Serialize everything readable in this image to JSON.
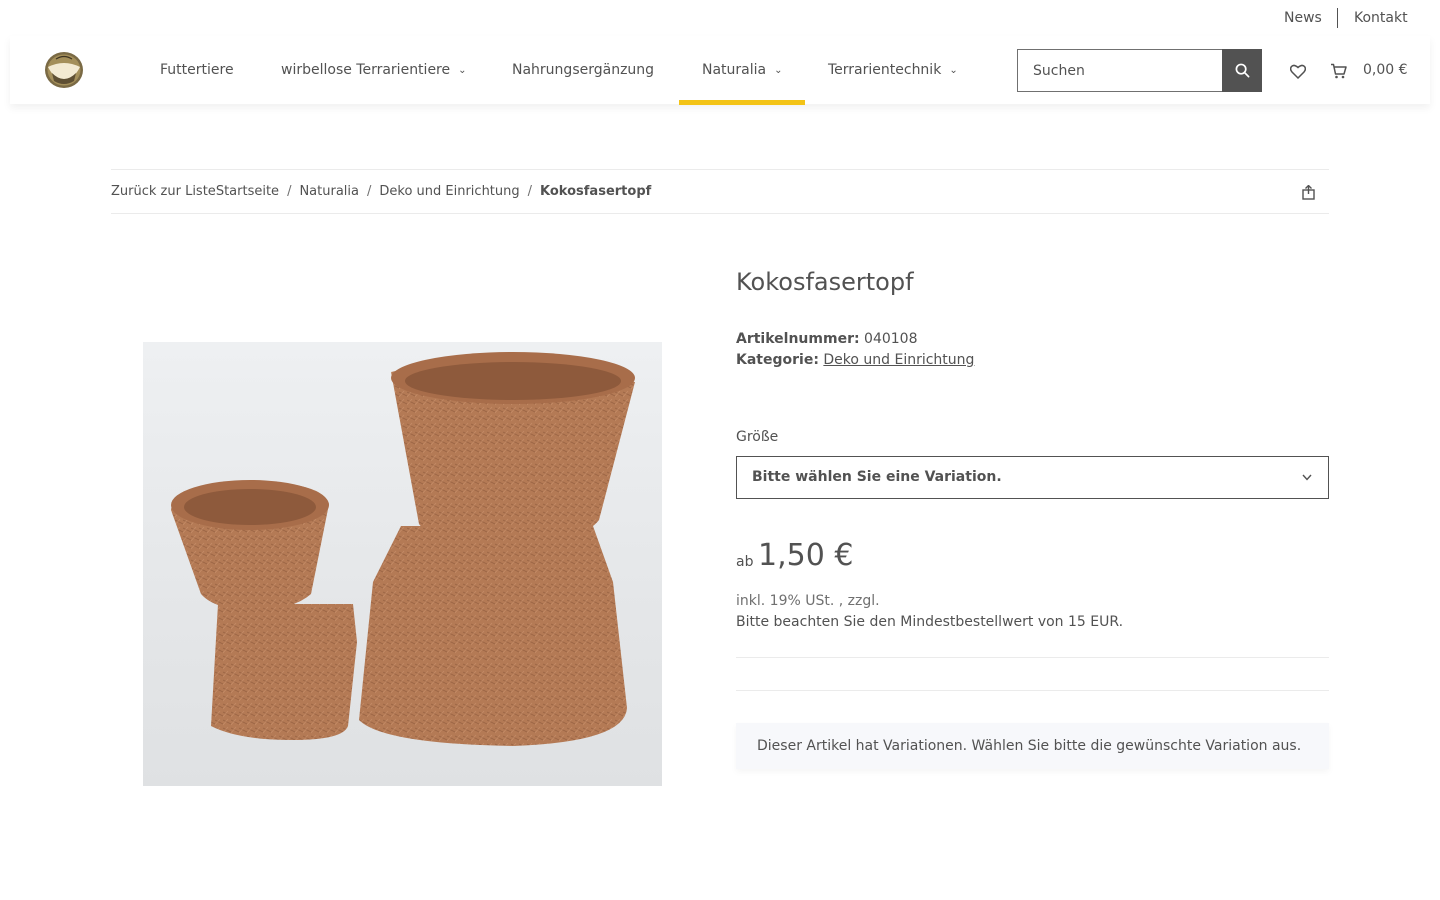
{
  "topbar": {
    "news": "News",
    "kontakt": "Kontakt"
  },
  "header": {
    "logo_icon": "shop-logo-icon",
    "nav": [
      {
        "label": "Futtertiere",
        "has_dropdown": false
      },
      {
        "label": "wirbellose Terrarientiere",
        "has_dropdown": true
      },
      {
        "label": "Nahrungsergänzung",
        "has_dropdown": false
      },
      {
        "label": "Naturalia",
        "has_dropdown": true,
        "active": true
      },
      {
        "label": "Terrarientechnik",
        "has_dropdown": true
      }
    ],
    "search_placeholder": "Suchen",
    "search_icon": "search-icon",
    "wishlist_icon": "heart-icon",
    "cart_icon": "shopping-cart-icon",
    "cart_total": "0,00 €",
    "active_color": "#f3c316"
  },
  "breadcrumb": {
    "back": "Zurück zur Liste",
    "items": [
      "Startseite",
      "Naturalia",
      "Deko und Einrichtung"
    ],
    "current": "Kokosfasertopf",
    "separator": "/",
    "share_icon": "share-icon"
  },
  "product": {
    "title": "Kokosfasertopf",
    "sku_label": "Artikelnummer:",
    "sku": "040108",
    "category_label": "Kategorie:",
    "category": "Deko und Einrichtung",
    "variation_label": "Größe",
    "variation_placeholder": "Bitte wählen Sie eine Variation.",
    "price_prefix": "ab",
    "price": "1,50 €",
    "vat": "inkl. 19% USt. , zzgl.",
    "min_order": "Bitte beachten Sie den Mindestbestellwert von 15 EUR.",
    "notice": "Dieser Artikel hat Variationen. Wählen Sie bitte die gewünschte Variation aus."
  }
}
